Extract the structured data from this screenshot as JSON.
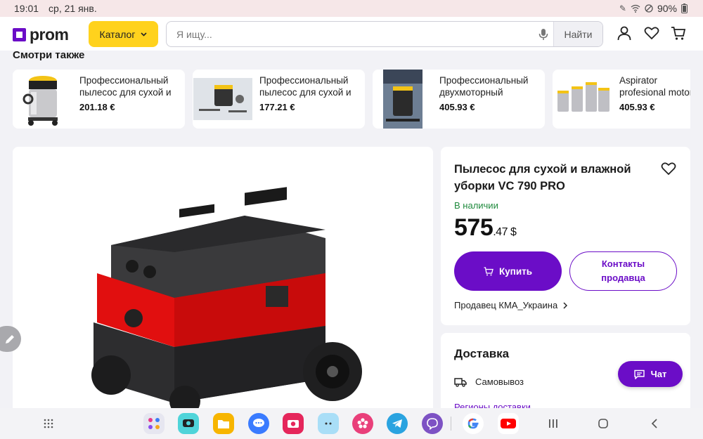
{
  "status_bar": {
    "time": "19:01",
    "date": "ср, 21 янв.",
    "battery": "90%",
    "icons": [
      "stylus-icon",
      "wifi-icon",
      "do-not-disturb-icon",
      "battery-icon"
    ]
  },
  "header": {
    "logo": "prom",
    "catalog_label": "Каталог",
    "search_placeholder": "Я ищу...",
    "search_button": "Найти",
    "icons": [
      "mic-icon",
      "user-icon",
      "heart-icon",
      "cart-icon"
    ]
  },
  "see_also": {
    "title": "Смотри также",
    "items": [
      {
        "title": "Профессиональный пылесос для сухой и влажной уборки",
        "price": "201.18 €"
      },
      {
        "title": "Профессиональный пылесос для сухой и влажной уборки",
        "price": "177.21 €"
      },
      {
        "title": "Профессиональный двухмоторный пылесос",
        "price": "405.93 €"
      },
      {
        "title": "Aspirator profesional motor dual SPEED",
        "price": "405.93 €"
      }
    ]
  },
  "product": {
    "title": "Пылесос для сухой и влажной уборки VC 790 PRO",
    "availability": "В наличии",
    "price_main": "575",
    "price_cents": ".47",
    "currency": "$",
    "buy_label": "Купить",
    "contact_label": "Контакты продавца",
    "seller": "Продавец КМА_Украина"
  },
  "delivery": {
    "title": "Доставка",
    "pickup": "Самовывоз",
    "regions": "Регионы доставки"
  },
  "chat_label": "Чат",
  "taskbar": {
    "apps": [
      "app-folder",
      "messenger",
      "files",
      "messages",
      "camera",
      "bixby",
      "blossom",
      "telegram",
      "viber",
      "google",
      "youtube"
    ]
  },
  "colors": {
    "brand_purple": "#6b0dc7",
    "catalog_yellow": "#ffd21d",
    "in_stock_green": "#1f8a3d"
  }
}
